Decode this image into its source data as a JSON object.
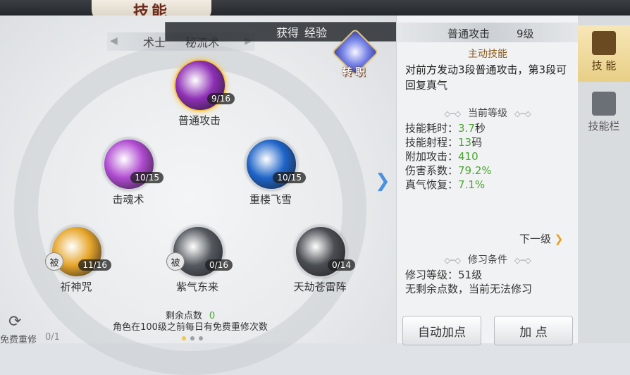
{
  "title": "技能",
  "class_bar": {
    "class": "术士",
    "school": "秘流术"
  },
  "toast": {
    "prefix": "获得",
    "value": "",
    "suffix": "经验"
  },
  "change_job": {
    "label": "转 职"
  },
  "skills": [
    {
      "name": "普通攻击",
      "level": "9/16",
      "passive": false,
      "selected": true,
      "color": "#8e2fb5"
    },
    {
      "name": "击魂术",
      "level": "10/15",
      "passive": false,
      "selected": false,
      "color": "#b04bd1"
    },
    {
      "name": "重楼飞雪",
      "level": "10/15",
      "passive": false,
      "selected": false,
      "color": "#1e64c8"
    },
    {
      "name": "祈神咒",
      "level": "11/16",
      "passive": true,
      "passive_label": "被",
      "selected": false,
      "color": "#e6a52a"
    },
    {
      "name": "紫气东来",
      "level": "0/16",
      "passive": true,
      "passive_label": "被",
      "selected": false,
      "color": "#555a60"
    },
    {
      "name": "天劫苍雷阵",
      "level": "0/14",
      "passive": false,
      "selected": false,
      "color": "#4a4d52"
    }
  ],
  "points": {
    "label": "剩余点数",
    "value": "0",
    "note": "角色在100级之前每日有免费重修次数"
  },
  "reset": {
    "label": "免费重修",
    "count": "0/1"
  },
  "detail": {
    "name": "普通攻击",
    "level": "9级",
    "type": "主动技能",
    "description": "对前方发动3段普通攻击，第3段可回复真气",
    "current_title": "当前等级",
    "stats": [
      {
        "label": "技能耗时：",
        "value": "3.7",
        "unit": "秒"
      },
      {
        "label": "技能射程：",
        "value": "13",
        "unit": "码"
      },
      {
        "label": "附加攻击：",
        "value": "410",
        "unit": ""
      },
      {
        "label": "伤害系数：",
        "value": "79.2%",
        "unit": ""
      },
      {
        "label": "真气恢复：",
        "value": "7.1%",
        "unit": ""
      }
    ],
    "next_label": "下一级",
    "req_title": "修习条件",
    "req_level": "修习等级：51级",
    "req_note": "无剩余点数，当前无法修习"
  },
  "buttons": {
    "auto": "自动加点",
    "add": "加 点"
  },
  "tabs": [
    {
      "label": "技 能",
      "active": true
    },
    {
      "label": "技能栏",
      "active": false
    }
  ]
}
